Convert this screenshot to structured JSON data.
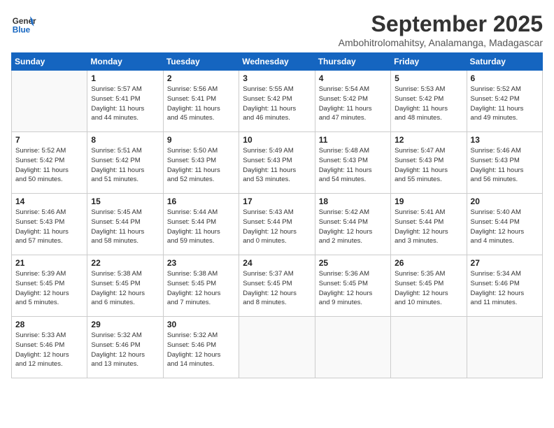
{
  "logo": {
    "line1": "General",
    "line2": "Blue"
  },
  "title": "September 2025",
  "subtitle": "Ambohitrolomahitsy, Analamanga, Madagascar",
  "days_of_week": [
    "Sunday",
    "Monday",
    "Tuesday",
    "Wednesday",
    "Thursday",
    "Friday",
    "Saturday"
  ],
  "weeks": [
    [
      {
        "day": "",
        "info": ""
      },
      {
        "day": "1",
        "info": "Sunrise: 5:57 AM\nSunset: 5:41 PM\nDaylight: 11 hours\nand 44 minutes."
      },
      {
        "day": "2",
        "info": "Sunrise: 5:56 AM\nSunset: 5:41 PM\nDaylight: 11 hours\nand 45 minutes."
      },
      {
        "day": "3",
        "info": "Sunrise: 5:55 AM\nSunset: 5:42 PM\nDaylight: 11 hours\nand 46 minutes."
      },
      {
        "day": "4",
        "info": "Sunrise: 5:54 AM\nSunset: 5:42 PM\nDaylight: 11 hours\nand 47 minutes."
      },
      {
        "day": "5",
        "info": "Sunrise: 5:53 AM\nSunset: 5:42 PM\nDaylight: 11 hours\nand 48 minutes."
      },
      {
        "day": "6",
        "info": "Sunrise: 5:52 AM\nSunset: 5:42 PM\nDaylight: 11 hours\nand 49 minutes."
      }
    ],
    [
      {
        "day": "7",
        "info": "Sunrise: 5:52 AM\nSunset: 5:42 PM\nDaylight: 11 hours\nand 50 minutes."
      },
      {
        "day": "8",
        "info": "Sunrise: 5:51 AM\nSunset: 5:42 PM\nDaylight: 11 hours\nand 51 minutes."
      },
      {
        "day": "9",
        "info": "Sunrise: 5:50 AM\nSunset: 5:43 PM\nDaylight: 11 hours\nand 52 minutes."
      },
      {
        "day": "10",
        "info": "Sunrise: 5:49 AM\nSunset: 5:43 PM\nDaylight: 11 hours\nand 53 minutes."
      },
      {
        "day": "11",
        "info": "Sunrise: 5:48 AM\nSunset: 5:43 PM\nDaylight: 11 hours\nand 54 minutes."
      },
      {
        "day": "12",
        "info": "Sunrise: 5:47 AM\nSunset: 5:43 PM\nDaylight: 11 hours\nand 55 minutes."
      },
      {
        "day": "13",
        "info": "Sunrise: 5:46 AM\nSunset: 5:43 PM\nDaylight: 11 hours\nand 56 minutes."
      }
    ],
    [
      {
        "day": "14",
        "info": "Sunrise: 5:46 AM\nSunset: 5:43 PM\nDaylight: 11 hours\nand 57 minutes."
      },
      {
        "day": "15",
        "info": "Sunrise: 5:45 AM\nSunset: 5:44 PM\nDaylight: 11 hours\nand 58 minutes."
      },
      {
        "day": "16",
        "info": "Sunrise: 5:44 AM\nSunset: 5:44 PM\nDaylight: 11 hours\nand 59 minutes."
      },
      {
        "day": "17",
        "info": "Sunrise: 5:43 AM\nSunset: 5:44 PM\nDaylight: 12 hours\nand 0 minutes."
      },
      {
        "day": "18",
        "info": "Sunrise: 5:42 AM\nSunset: 5:44 PM\nDaylight: 12 hours\nand 2 minutes."
      },
      {
        "day": "19",
        "info": "Sunrise: 5:41 AM\nSunset: 5:44 PM\nDaylight: 12 hours\nand 3 minutes."
      },
      {
        "day": "20",
        "info": "Sunrise: 5:40 AM\nSunset: 5:44 PM\nDaylight: 12 hours\nand 4 minutes."
      }
    ],
    [
      {
        "day": "21",
        "info": "Sunrise: 5:39 AM\nSunset: 5:45 PM\nDaylight: 12 hours\nand 5 minutes."
      },
      {
        "day": "22",
        "info": "Sunrise: 5:38 AM\nSunset: 5:45 PM\nDaylight: 12 hours\nand 6 minutes."
      },
      {
        "day": "23",
        "info": "Sunrise: 5:38 AM\nSunset: 5:45 PM\nDaylight: 12 hours\nand 7 minutes."
      },
      {
        "day": "24",
        "info": "Sunrise: 5:37 AM\nSunset: 5:45 PM\nDaylight: 12 hours\nand 8 minutes."
      },
      {
        "day": "25",
        "info": "Sunrise: 5:36 AM\nSunset: 5:45 PM\nDaylight: 12 hours\nand 9 minutes."
      },
      {
        "day": "26",
        "info": "Sunrise: 5:35 AM\nSunset: 5:45 PM\nDaylight: 12 hours\nand 10 minutes."
      },
      {
        "day": "27",
        "info": "Sunrise: 5:34 AM\nSunset: 5:46 PM\nDaylight: 12 hours\nand 11 minutes."
      }
    ],
    [
      {
        "day": "28",
        "info": "Sunrise: 5:33 AM\nSunset: 5:46 PM\nDaylight: 12 hours\nand 12 minutes."
      },
      {
        "day": "29",
        "info": "Sunrise: 5:32 AM\nSunset: 5:46 PM\nDaylight: 12 hours\nand 13 minutes."
      },
      {
        "day": "30",
        "info": "Sunrise: 5:32 AM\nSunset: 5:46 PM\nDaylight: 12 hours\nand 14 minutes."
      },
      {
        "day": "",
        "info": ""
      },
      {
        "day": "",
        "info": ""
      },
      {
        "day": "",
        "info": ""
      },
      {
        "day": "",
        "info": ""
      }
    ]
  ]
}
